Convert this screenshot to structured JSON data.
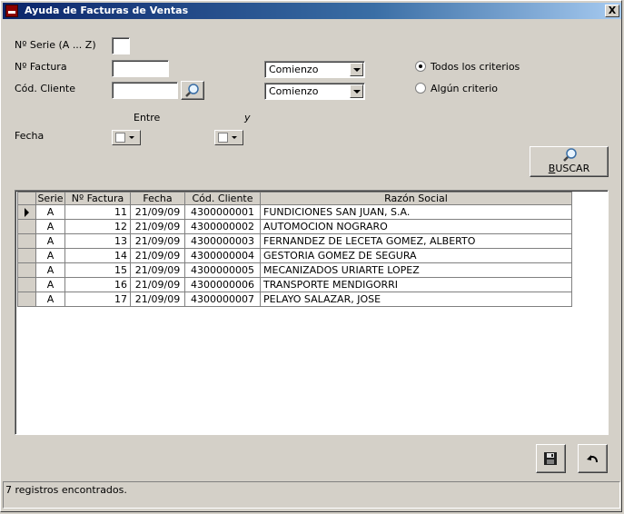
{
  "window": {
    "title": "Ayuda de Facturas de Ventas",
    "close": "X"
  },
  "form": {
    "serie_label": "Nº Serie (A ... Z)",
    "factura_label": "Nº Factura",
    "cliente_label": "Cód. Cliente",
    "factura_match": "Comienzo",
    "cliente_match": "Comienzo",
    "entre_label": "Entre",
    "y_label": "y",
    "fecha_label": "Fecha"
  },
  "criteria": {
    "todos": "Todos los criterios",
    "alguno": "Algún criterio",
    "selected": "todos"
  },
  "search_button": {
    "label_pre": "",
    "label_u": "B",
    "label_post": "USCAR",
    "icon": "magnifier-icon"
  },
  "table": {
    "columns": [
      "Serie",
      "Nº Factura",
      "Fecha",
      "Cód. Cliente",
      "Razón Social"
    ],
    "rows": [
      [
        "A",
        "11",
        "21/09/09",
        "4300000001",
        "FUNDICIONES SAN JUAN, S.A."
      ],
      [
        "A",
        "12",
        "21/09/09",
        "4300000002",
        "AUTOMOCION NOGRARO"
      ],
      [
        "A",
        "13",
        "21/09/09",
        "4300000003",
        "FERNANDEZ DE LECETA GOMEZ, ALBERTO"
      ],
      [
        "A",
        "14",
        "21/09/09",
        "4300000004",
        "GESTORIA GOMEZ DE SEGURA"
      ],
      [
        "A",
        "15",
        "21/09/09",
        "4300000005",
        "MECANIZADOS URIARTE LOPEZ"
      ],
      [
        "A",
        "16",
        "21/09/09",
        "4300000006",
        "TRANSPORTE MENDIGORRI"
      ],
      [
        "A",
        "17",
        "21/09/09",
        "4300000007",
        "PELAYO SALAZAR, JOSE"
      ]
    ]
  },
  "status": {
    "text": "7 registros encontrados."
  }
}
